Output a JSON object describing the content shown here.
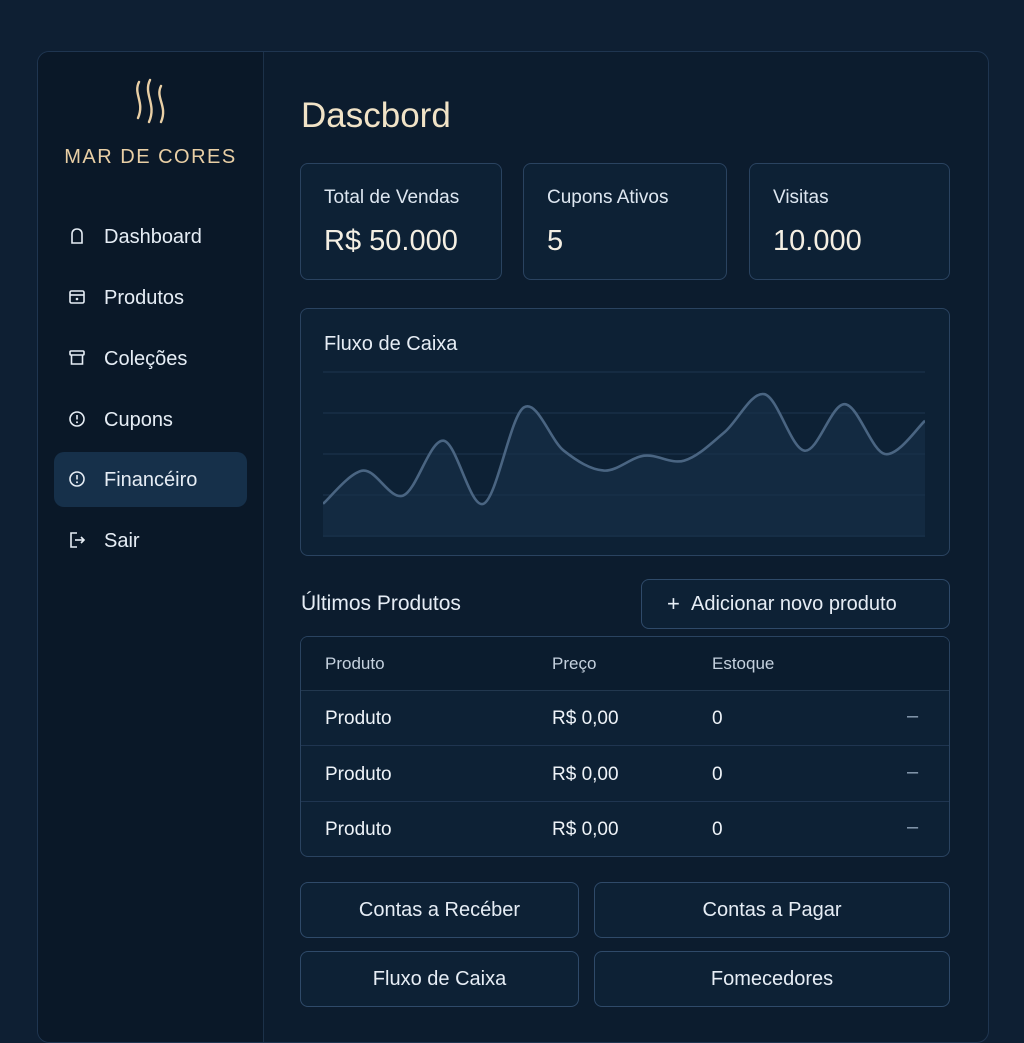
{
  "brand": {
    "name": "MAR DE CORES",
    "logo_icon": "flame-waves-icon",
    "color": "#e9cfa5"
  },
  "sidebar": {
    "items": [
      {
        "label": "Dashboard",
        "icon": "home-icon",
        "active": false
      },
      {
        "label": "Produtos",
        "icon": "box-icon",
        "active": false
      },
      {
        "label": "Coleções",
        "icon": "archive-icon",
        "active": false
      },
      {
        "label": "Cupons",
        "icon": "coupon-icon",
        "active": false
      },
      {
        "label": "Financéiro",
        "icon": "finance-icon",
        "active": true
      },
      {
        "label": "Sair",
        "icon": "logout-icon",
        "active": false
      }
    ]
  },
  "page": {
    "title": "Dascbord"
  },
  "stats": [
    {
      "label": "Total de Vendas",
      "value": "R$ 50.000"
    },
    {
      "label": "Cupons Ativos",
      "value": "5"
    },
    {
      "label": "Visitas",
      "value": "10.000"
    }
  ],
  "cashflow": {
    "title": "Fluxo de Caixa",
    "chart_data": {
      "type": "area",
      "title": "Fluxo de Caixa",
      "xlabel": "",
      "ylabel": "",
      "grid": true,
      "ylim": [
        0,
        100
      ],
      "x": [
        0,
        1,
        2,
        3,
        4,
        5,
        6,
        7,
        8,
        9,
        10,
        11,
        12,
        13,
        14,
        15
      ],
      "values": [
        20,
        40,
        25,
        58,
        20,
        78,
        52,
        40,
        49,
        46,
        63,
        86,
        52,
        80,
        50,
        70
      ]
    }
  },
  "products": {
    "title": "Últimos Produtos",
    "add_button": {
      "plus": "+",
      "label": "Adicionar novo produto"
    },
    "columns": [
      "Produto",
      "Preço",
      "Estoque"
    ],
    "rows": [
      {
        "product": "Produto",
        "price": "R$ 0,00",
        "stock": "0",
        "action": "–"
      },
      {
        "product": "Produto",
        "price": "R$ 0,00",
        "stock": "0",
        "action": "–"
      },
      {
        "product": "Produto",
        "price": "R$ 0,00",
        "stock": "0",
        "action": "–"
      }
    ]
  },
  "finance_buttons": [
    "Contas a Recéber",
    "Contas a Pagar",
    "Fluxo de Caixa",
    "Fomecedores"
  ],
  "colors": {
    "background": "#0e1f33",
    "panel": "#0d2135",
    "accent": "#f1e3c7",
    "line": "#4a6582"
  }
}
